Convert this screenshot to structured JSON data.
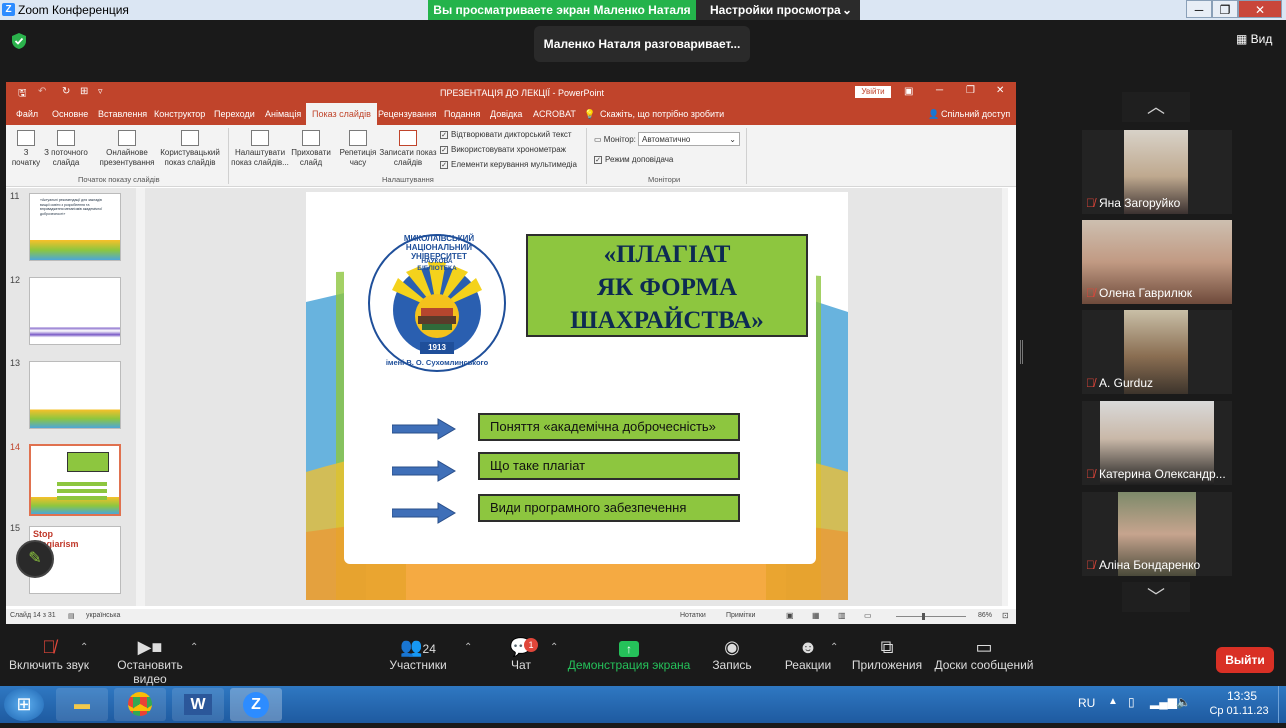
{
  "zoom": {
    "window_title": "Zoom Конференция",
    "share_banner": "Вы просматриваете экран Маленко Наталя",
    "view_options": "Настройки просмотра",
    "talking": "Маленко Наталя разговаривает...",
    "view_button": "Вид",
    "leave": "Выйти"
  },
  "ppt": {
    "title": "ПРЕЗЕНТАЦІЯ ДО ЛЕКЦІЇ  -  PowerPoint",
    "signin": "Увійти",
    "share": "Спільний доступ",
    "tellme": "Скажіть, що потрібно зробити",
    "menu": [
      "Файл",
      "Основне",
      "Вставлення",
      "Конструктор",
      "Переходи",
      "Анімація",
      "Показ слайдів",
      "Рецензування",
      "Подання",
      "Довідка",
      "ACROBAT"
    ],
    "ribbon": {
      "from_start": "З початку",
      "from_current": "З поточного слайда",
      "online": "Онлайнове презентування",
      "custom": "Користувацький показ слайдів",
      "setup": "Налаштувати показ слайдів...",
      "hide": "Приховати слайд",
      "rehearse": "Репетиція часу",
      "record": "Записати показ слайдів",
      "chk_narration": "Відтворювати дикторський текст",
      "chk_timings": "Використовувати хронометраж",
      "chk_media": "Елементи керування мультимедіа",
      "monitor_label": "Монітор:",
      "monitor_value": "Автоматично",
      "presenter": "Режим доповідача",
      "group_start": "Початок показу слайдів",
      "group_setup": "Налаштування",
      "group_monitors": "Монітори"
    },
    "thumb_numbers": [
      "11",
      "12",
      "13",
      "14",
      "15"
    ],
    "thumb11_text": "«Актуальні рекомендації для закладів вищої освіти з розроблення та впровадження механізмів академічної доброчесності»",
    "thumb15_text": "Stop Plagiarism",
    "slide": {
      "logo_top": "МИКОЛАЇВСЬКИЙ НАЦІОНАЛЬНИЙ УНІВЕРСИТЕТ",
      "logo_bottom": "імені В. О. Сухомлинського",
      "logo_lib": "НАУКОВА БІБЛІОТЕКА",
      "logo_year": "1913",
      "title_line1": "«ПЛАГІАТ",
      "title_line2": "ЯК ФОРМА",
      "title_line3": "ШАХРАЙСТВА»",
      "items": [
        "Поняття «академічна доброчесність»",
        "Що таке плагіат",
        "Види програмного забезпечення"
      ]
    },
    "status": {
      "slide_counter": "Слайд 14 з 31",
      "language": "українська",
      "notes": "Нотатки",
      "comments": "Примітки",
      "zoom": "86%"
    }
  },
  "participants": [
    {
      "name": "Яна Загоруйко"
    },
    {
      "name": "Олена Гаврилюк"
    },
    {
      "name": "A. Gurduz"
    },
    {
      "name": "Катерина Олександр..."
    },
    {
      "name": "Аліна Бондаренко"
    }
  ],
  "toolbar": {
    "unmute": "Включить звук",
    "video": "Остановить видео",
    "participants": "Участники",
    "participants_count": "24",
    "chat": "Чат",
    "chat_badge": "1",
    "share": "Демонстрация экрана",
    "record": "Запись",
    "reactions": "Реакции",
    "apps": "Приложения",
    "whiteboards": "Доски сообщений"
  },
  "taskbar": {
    "lang": "RU",
    "time": "13:35",
    "date": "Ср 01.11.23"
  },
  "colors": {
    "ppt_red": "#c0442b",
    "slide_green": "#8dc63f",
    "share_green": "#24b34b",
    "leave_red": "#d93025"
  }
}
